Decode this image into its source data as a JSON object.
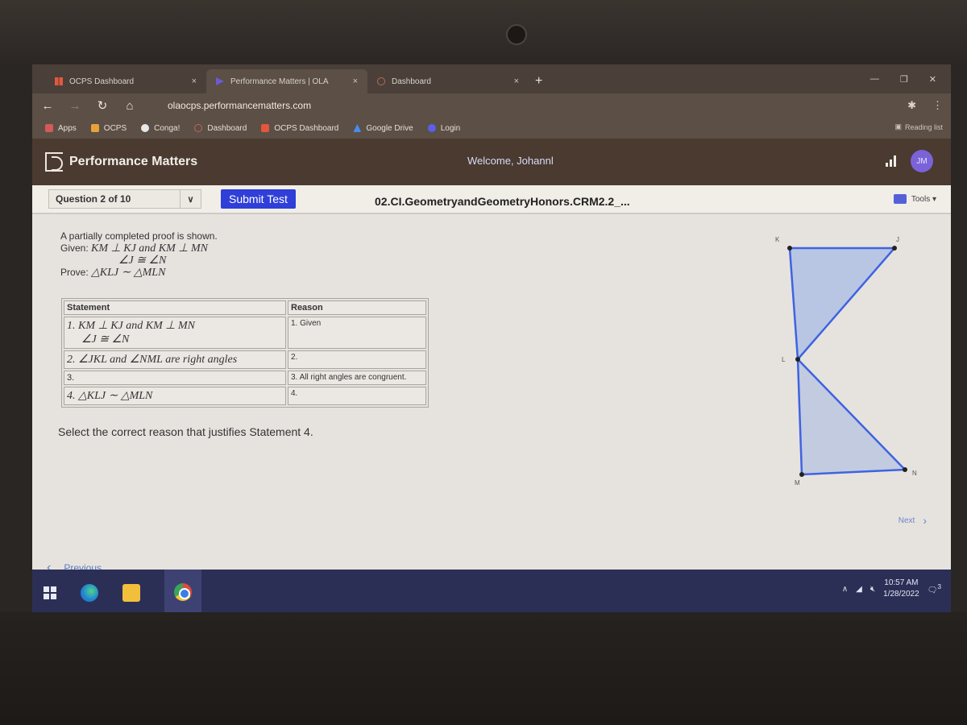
{
  "browser": {
    "tabs": [
      {
        "label": "OCPS Dashboard",
        "icon": "grid-icon",
        "active": false
      },
      {
        "label": "Performance Matters | OLA",
        "icon": "pm-icon",
        "active": true
      },
      {
        "label": "Dashboard",
        "icon": "dashboard-icon",
        "active": false
      }
    ],
    "new_tab": "+",
    "close_glyph": "×",
    "url": "olaocps.performancematters.com",
    "bookmarks": [
      {
        "label": "Apps",
        "color": "#d45a5a"
      },
      {
        "label": "OCPS",
        "color": "#e8a23a"
      },
      {
        "label": "Conga!",
        "color": "#e8e8e8"
      },
      {
        "label": "Dashboard",
        "color": "#b86a5a"
      },
      {
        "label": "OCPS Dashboard",
        "color": "#e4573d"
      },
      {
        "label": "Google Drive",
        "color": "#4a8af0"
      },
      {
        "label": "Login",
        "color": "#5a60e6"
      }
    ],
    "reading_list": "Reading list"
  },
  "app": {
    "brand": "Performance Matters",
    "welcome": "Welcome, Johannl",
    "avatar_initials": "JM",
    "question_selector": "Question 2 of 10",
    "submit_label": "Submit Test",
    "test_title": "02.CI.GeometryandGeometryHonors.CRM2.2_...",
    "tools_label": "Tools ▾",
    "accent": "#2f3fd8"
  },
  "question": {
    "intro": "A partially completed proof is shown.",
    "given_label": "Given:",
    "given_line1": "KM ⊥ KJ  and  KM ⊥ MN",
    "given_line2": "∠J ≅ ∠N",
    "prove_label": "Prove:",
    "prove": "△KLJ ∼ △MLN",
    "table": {
      "headers": [
        "Statement",
        "Reason"
      ],
      "rows": [
        {
          "statement": "1. KM ⊥ KJ  and  KM ⊥ MN",
          "statement_sub": "∠J ≅ ∠N",
          "reason": "1. Given"
        },
        {
          "statement": "2. ∠JKL and ∠NML are right angles",
          "statement_sub": "",
          "reason": "2."
        },
        {
          "statement": "3.",
          "statement_sub": "",
          "reason": "3. All right angles are congruent."
        },
        {
          "statement": "4. △KLJ ∼ △MLN",
          "statement_sub": "",
          "reason": "4."
        }
      ]
    },
    "instruction": "Select the correct reason that justifies Statement 4.",
    "diagram": {
      "points": {
        "K": "K",
        "J": "J",
        "L": "L",
        "M": "M",
        "N": "N"
      },
      "fill": "#b8c6e4",
      "stroke": "#3f63e0"
    }
  },
  "navigation": {
    "next_label": "Next",
    "previous_label": "Previous"
  },
  "taskbar": {
    "time": "10:57 AM",
    "date": "1/28/2022",
    "notification_count": "3"
  }
}
